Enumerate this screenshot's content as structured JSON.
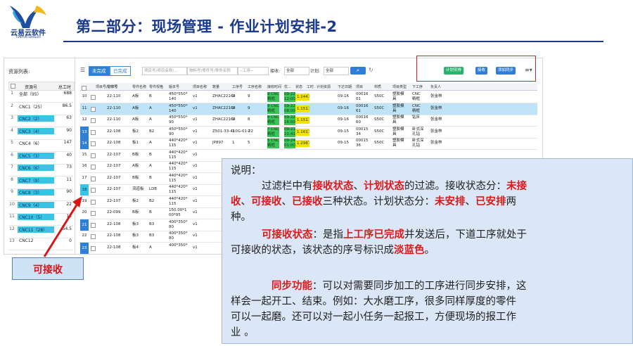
{
  "header": {
    "logo_text": "云易云软件",
    "logo_sub": "YUNYUN Software",
    "title": "第二部分：现场管理 - 作业计划安排-2"
  },
  "left_panel": {
    "title": "资源列表:",
    "col_name": "资源号",
    "col_val": "总工时",
    "rows": [
      {
        "n": "1",
        "name": "全部（95）",
        "val": "688",
        "hl": false
      },
      {
        "n": "2",
        "name": "CNC1（25）",
        "val": "86.5",
        "hl": false
      },
      {
        "n": "3",
        "name": "CNC2（2）",
        "val": "63",
        "hl": true
      },
      {
        "n": "4",
        "name": "CNC3（4）",
        "val": "90",
        "hl": true
      },
      {
        "n": "5",
        "name": "CNC4（6）",
        "val": "147",
        "hl": false
      },
      {
        "n": "6",
        "name": "CNC5（3）",
        "val": "40",
        "hl": true
      },
      {
        "n": "7",
        "name": "CNC6（6）",
        "val": "73",
        "hl": true
      },
      {
        "n": "8",
        "name": "CNC7（9）",
        "val": "11",
        "hl": true
      },
      {
        "n": "9",
        "name": "CNC8（3）",
        "val": "90",
        "hl": true
      },
      {
        "n": "10",
        "name": "CNC9（4）",
        "val": "22",
        "hl": true
      },
      {
        "n": "11",
        "name": "CNC10（5）",
        "val": "13",
        "hl": true
      },
      {
        "n": "12",
        "name": "CNC11（28）",
        "val": "54.5",
        "hl": true
      },
      {
        "n": "13",
        "name": "CNC12",
        "val": "0",
        "hl": false
      }
    ]
  },
  "toolbar": {
    "tab_incomplete": "未完成",
    "tab_complete": "已完成",
    "ph_project": "项目号/项目名称/…",
    "ph_part": "物料号/零件号/零件名称",
    "ph_process": "--工序--",
    "label_receive": "接收:",
    "receive_value": "全部",
    "label_plan": "计划:",
    "plan_value": "全部",
    "btn_plan": "计划安排",
    "btn_recv": "接收",
    "btn_sync": "添加同步"
  },
  "grid": {
    "headers": [
      "项目号/订单号",
      "零件号",
      "零件名称",
      "零件规格",
      "版本号",
      "项目名称",
      "数量",
      "工序号",
      "工序名称",
      "接收时间",
      "优…",
      "状态",
      "工时",
      "计划资源",
      "下达日期",
      "项目",
      "材质",
      "项目类型",
      "下工序",
      "负责人"
    ],
    "rows": [
      {
        "idx": "10",
        "style": "plain",
        "sel": false,
        "order": "22-110",
        "part": "A板",
        "name": "B",
        "spec": "450*550*\n140",
        "ver": "v1",
        "proj": "ZHAC22164",
        "qty": "1",
        "op": "9",
        "opname": "9 CNC\n精框",
        "time": "09-22\n12:00",
        "pri": "1.144",
        "date": "09-16",
        "code": "00016\n01",
        "mat": "S50C",
        "ptype": "塑胶模\n具",
        "next": "CNC\n精框",
        "owner": "张金林"
      },
      {
        "idx": "11",
        "style": "plain",
        "sel": true,
        "order": "22-110",
        "part": "A板",
        "name": "A",
        "spec": "450*550*\n140",
        "ver": "v1",
        "proj": "ZHAC22164",
        "qty": "1",
        "op": "9",
        "opname": "9 CNC\n精框",
        "time": "09-22\n08:00",
        "pri": "1.151",
        "date": "09-16",
        "code": "00016\n61",
        "mat": "S50C",
        "ptype": "塑胶模\n具",
        "next": "CNC\n精框",
        "owner": "张金林"
      },
      {
        "idx": "12",
        "style": "plain",
        "sel": false,
        "order": "22-110",
        "part": "A板",
        "name": "A",
        "spec": "450*550*\n90",
        "ver": "v1",
        "proj": "ZHAC22164",
        "qty": "1",
        "op": "8",
        "opname": "8 CNC\n精框",
        "time": "09-22\n16:00",
        "pri": "1.151",
        "date": "09-16",
        "code": "00016\n60",
        "mat": "S50C",
        "ptype": "塑胶模\n具",
        "next": "钻床",
        "owner": "张金林"
      },
      {
        "idx": "13",
        "style": "blue",
        "sel": false,
        "order": "22-108",
        "part": "板2",
        "name": "B2",
        "spec": "450*550*\n90",
        "ver": "v1",
        "proj": "Z501-33-410G-01-22",
        "qty": "1",
        "op": "7",
        "opname": "7 CNC\n精框",
        "time": "09-21\n21:41",
        "pri": "1.161",
        "date": "09-15",
        "code": "00015\n34",
        "mat": "S50C",
        "ptype": "塑胶模\n具",
        "next": "卧式深\n孔钻",
        "owner": "张金林"
      },
      {
        "idx": "14",
        "style": "blue",
        "sel": false,
        "order": "22-108",
        "part": "板1",
        "name": "A",
        "spec": "440*420*\n115",
        "ver": "v1",
        "proj": "JP897",
        "qty": "1",
        "op": "5",
        "opname": "5 CNC\n精框",
        "time": "09-24\n01:00",
        "pri": "1.298",
        "date": "09-15",
        "code": "00015\n36",
        "mat": "S50C",
        "ptype": "塑胶模\n具",
        "next": "卧式深\n孔钻",
        "owner": "张金林"
      },
      {
        "idx": "15",
        "style": "plain",
        "sel": false,
        "order": "22-107",
        "part": "B板",
        "name": "B",
        "spec": "440*420*\n115",
        "ver": "v1",
        "proj": "",
        "qty": "",
        "op": "",
        "opname": "",
        "time": "",
        "pri": "",
        "date": "",
        "code": "",
        "mat": "",
        "ptype": "",
        "next": "",
        "owner": ""
      },
      {
        "idx": "16",
        "style": "plain",
        "sel": false,
        "order": "22-107",
        "part": "A板",
        "name": "A",
        "spec": "440*420*\n115",
        "ver": "v1",
        "proj": "",
        "qty": "",
        "op": "",
        "opname": "",
        "time": "",
        "pri": "",
        "date": "",
        "code": "",
        "mat": "",
        "ptype": "",
        "next": "",
        "owner": ""
      },
      {
        "idx": "17",
        "style": "plain",
        "sel": false,
        "order": "22-107",
        "part": "B板",
        "name": "B",
        "spec": "440*420*\n115",
        "ver": "v1",
        "proj": "",
        "qty": "",
        "op": "",
        "opname": "",
        "time": "",
        "pri": "",
        "date": "",
        "code": "",
        "mat": "",
        "ptype": "",
        "next": "",
        "owner": ""
      },
      {
        "idx": "18",
        "style": "cyan",
        "sel": false,
        "order": "22-107",
        "part": "流道板",
        "name": "LDB",
        "spec": "440*420*\n115",
        "ver": "v1",
        "proj": "",
        "qty": "",
        "op": "",
        "opname": "",
        "time": "",
        "pri": "",
        "date": "",
        "code": "",
        "mat": "",
        "ptype": "",
        "next": "",
        "owner": ""
      },
      {
        "idx": "19",
        "style": "plain",
        "sel": false,
        "order": "22-107",
        "part": "板2",
        "name": "B2",
        "spec": "440*420*\n115",
        "ver": "v1",
        "proj": "",
        "qty": "",
        "op": "",
        "opname": "",
        "time": "",
        "pri": "",
        "date": "",
        "code": "",
        "mat": "",
        "ptype": "",
        "next": "",
        "owner": ""
      },
      {
        "idx": "20",
        "style": "plain",
        "sel": false,
        "order": "22-099",
        "part": "B板",
        "name": "B",
        "spec": "150.00*1\n00*95",
        "ver": "v1",
        "proj": "",
        "qty": "",
        "op": "",
        "opname": "",
        "time": "",
        "pri": "",
        "date": "",
        "code": "",
        "mat": "",
        "ptype": "",
        "next": "",
        "owner": ""
      },
      {
        "idx": "21",
        "style": "blue",
        "sel": false,
        "order": "22-108",
        "part": "板3",
        "name": "B3",
        "spec": "400*350*\n80",
        "ver": "v1",
        "proj": "",
        "qty": "",
        "op": "",
        "opname": "",
        "time": "",
        "pri": "",
        "date": "",
        "code": "",
        "mat": "",
        "ptype": "",
        "next": "",
        "owner": ""
      },
      {
        "idx": "22",
        "style": "plain",
        "sel": false,
        "order": "22-108",
        "part": "板3",
        "name": "B3",
        "spec": "400*350*\n80",
        "ver": "v1",
        "proj": "",
        "qty": "",
        "op": "",
        "opname": "",
        "time": "",
        "pri": "",
        "date": "",
        "code": "",
        "mat": "",
        "ptype": "",
        "next": "",
        "owner": ""
      },
      {
        "idx": "23",
        "style": "blue",
        "sel": false,
        "order": "22-108",
        "part": "板4",
        "name": "A",
        "spec": "400*350*\n",
        "ver": "v1",
        "proj": "",
        "qty": "",
        "op": "",
        "opname": "",
        "time": "",
        "pri": "",
        "date": "",
        "code": "",
        "mat": "",
        "ptype": "",
        "next": "",
        "owner": ""
      }
    ]
  },
  "callout": {
    "label": "可接收"
  },
  "note": {
    "title": "说明：",
    "p1_a": "过滤栏中有",
    "p1_b": "接收状态",
    "p1_c": "、",
    "p1_d": "计划状态",
    "p1_e": "的过滤。接收状态分：",
    "p1_f": "未接",
    "p2_a": "收",
    "p2_b": "、",
    "p2_c": "可接收",
    "p2_d": "、",
    "p2_e": "已接收",
    "p2_f": "三种状态。计划状态分：",
    "p2_g": "未安排",
    "p2_h": "、",
    "p2_i": "已安排",
    "p2_j": "两",
    "p3": "种。",
    "p4_a": "可接收状态",
    "p4_b": "：是指",
    "p4_c": "上工序已完成",
    "p4_d": "并发送后，下道工序就处于",
    "p5_a": "可接收的状态，该状态的序号标识成",
    "p5_b": "淡蓝色",
    "p5_c": "。",
    "p6_a": "同步功能",
    "p6_b": "：可以对需要同步加工的工序进行同步安排，这",
    "p7": "样会一起开工、结束。例如：大水磨工序，很多同样厚度的零件",
    "p8": "可以一起磨。还可以对一起小任务一起报工，方便现场的报工作",
    "p9": "业  。"
  },
  "colors": {
    "title": "#1b3a8c",
    "highlight_cyan": "#39c4e6",
    "highlight_blue": "#2f7fd6",
    "red": "#e01919"
  }
}
